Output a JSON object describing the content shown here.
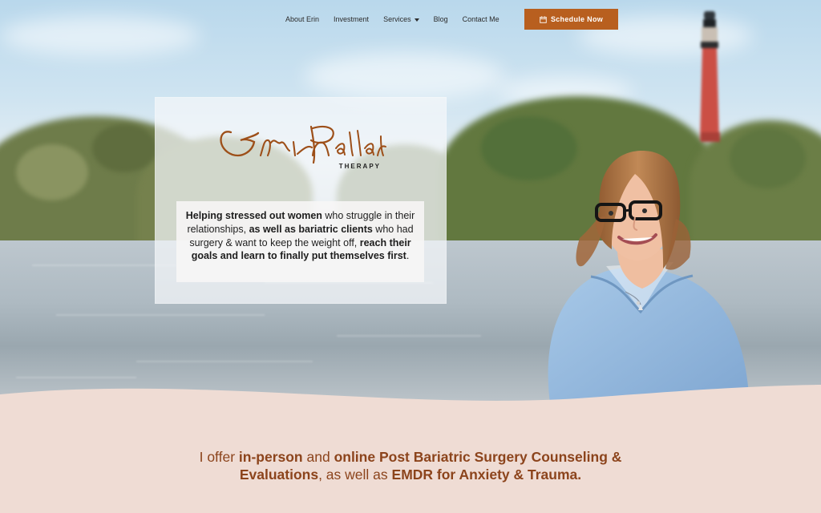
{
  "nav": {
    "items": [
      {
        "label": "About Erin"
      },
      {
        "label": "Investment"
      },
      {
        "label": "Services"
      },
      {
        "label": "Blog"
      },
      {
        "label": "Contact Me"
      }
    ],
    "schedule_label": "Schedule Now"
  },
  "logo": {
    "name": "Erin Pallard",
    "subtitle": "THERAPY"
  },
  "hero": {
    "tagline": {
      "part1": "Helping stressed out women",
      "part2": " who struggle in their relationships, ",
      "part3": "as well as bariatric clients",
      "part4": " who had surgery & want to keep the weight off, ",
      "part5": "reach their goals and learn to finally put themselves first",
      "part6": "."
    }
  },
  "offer": {
    "part1": "I offer ",
    "part2": "in-person",
    "part3": " and ",
    "part4": "online Post Bariatric Surgery Counseling & Evaluations",
    "part5": ", as well as ",
    "part6": "EMDR for Anxiety & Trauma."
  },
  "colors": {
    "accent": "#b85f1f",
    "logo": "#9d4f19",
    "bottom_bg": "#efdcd4"
  },
  "icons": {
    "calendar": "calendar-icon",
    "services_caret": "chevron-down-icon"
  }
}
